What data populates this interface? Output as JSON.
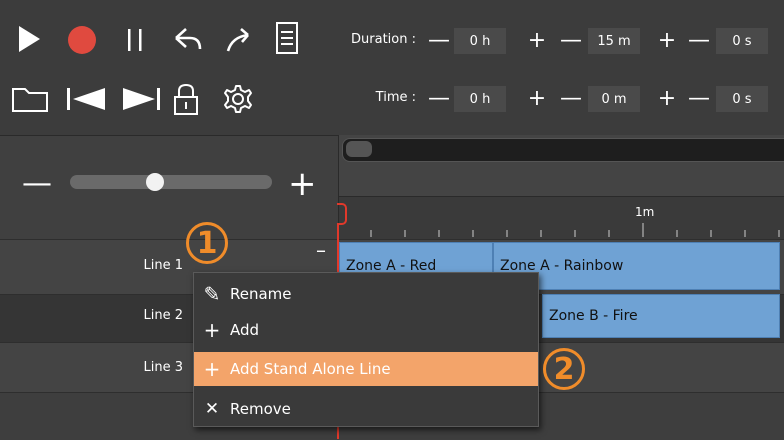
{
  "toolbar": {
    "duration_label": "Duration :",
    "time_label": "Time :",
    "minus": "—",
    "plus": "+",
    "duration": {
      "hours": "0 h",
      "minutes": "15 m",
      "seconds": "0 s"
    },
    "time": {
      "hours": "0 h",
      "minutes": "0 m",
      "seconds": "0 s"
    },
    "icons": [
      "play-icon",
      "record-icon",
      "pause-icon",
      "undo-icon",
      "redo-icon",
      "list-icon",
      "folder-icon",
      "skip-start-icon",
      "skip-end-icon",
      "lock-icon",
      "gear-icon"
    ]
  },
  "zoom": {
    "minus": "—",
    "plus": "+",
    "level": 0.5
  },
  "ruler": {
    "mark_label": "1m"
  },
  "lines": [
    {
      "label": "Line 1",
      "collapse": "–"
    },
    {
      "label": "Line 2"
    },
    {
      "label": "Line 3"
    }
  ],
  "clips": {
    "line1": [
      "Zone A - Red",
      "Zone A - Rainbow"
    ],
    "line2": [
      "Zone B - Fire"
    ]
  },
  "context_menu": {
    "items": [
      {
        "label": "Rename",
        "icon": "pencil-icon",
        "glyph": "✎"
      },
      {
        "label": "Add",
        "icon": "plus-icon",
        "glyph": "+"
      },
      {
        "label": "Add Stand Alone Line",
        "icon": "plus-icon",
        "glyph": "+"
      },
      {
        "label": "Remove",
        "icon": "close-icon",
        "glyph": "✕"
      }
    ]
  },
  "callouts": [
    "1",
    "2"
  ],
  "colors": {
    "accent": "#f08c2a",
    "highlight": "#f3a46a",
    "clip": "#6fa2d4",
    "record": "#e04a3f",
    "playhead": "#e0392b"
  }
}
